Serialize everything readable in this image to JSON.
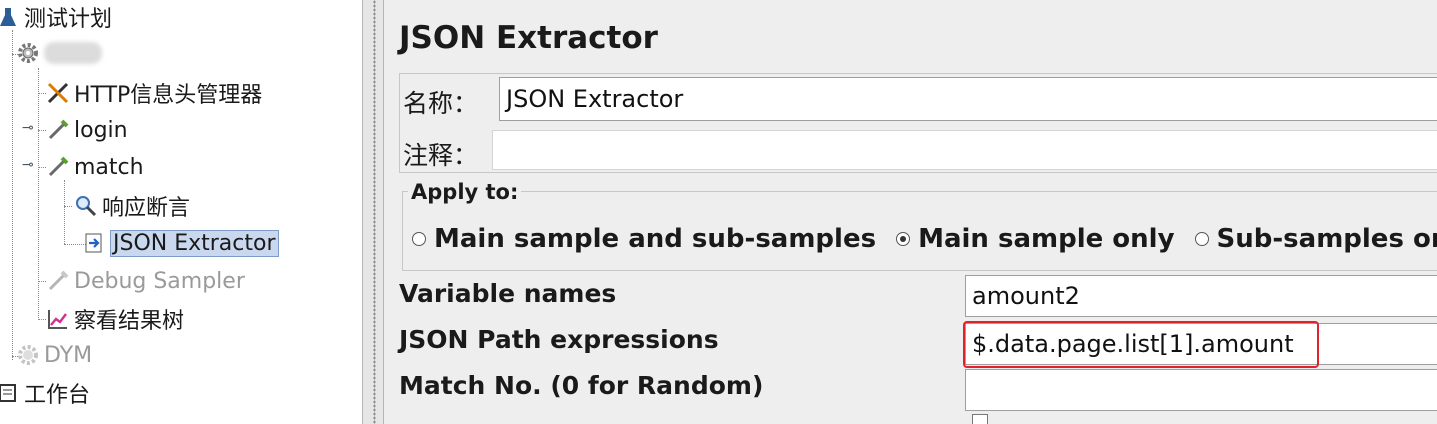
{
  "tree": {
    "root": "测试计划",
    "thread_group": "",
    "header_manager": "HTTP信息头管理器",
    "sampler_login": "login",
    "sampler_match": "match",
    "assertion": "响应断言",
    "extractor": "JSON Extractor",
    "debug_sampler": "Debug Sampler",
    "result_tree": "察看结果树",
    "thread_group_2": "DYM",
    "workbench": "工作台"
  },
  "editor": {
    "title": "JSON Extractor",
    "name_label": "名称：",
    "name_value": "JSON Extractor",
    "comment_label": "注释：",
    "comment_value": "",
    "apply_to": {
      "legend": "Apply to:",
      "options": [
        "Main sample and sub-samples",
        "Main sample only",
        "Sub-samples only"
      ],
      "selected": "Main sample only"
    },
    "variable_names_label": "Variable names",
    "variable_names_value": "amount2",
    "json_path_label": "JSON Path expressions",
    "json_path_value": "$.data.page.list[1].amount",
    "match_no_label": "Match No. (0 for Random)",
    "match_no_value": ""
  },
  "colors": {
    "selection_bg": "#c9d8ee",
    "highlight_border": "#e0222c",
    "panel_bg": "#eeeeee"
  }
}
